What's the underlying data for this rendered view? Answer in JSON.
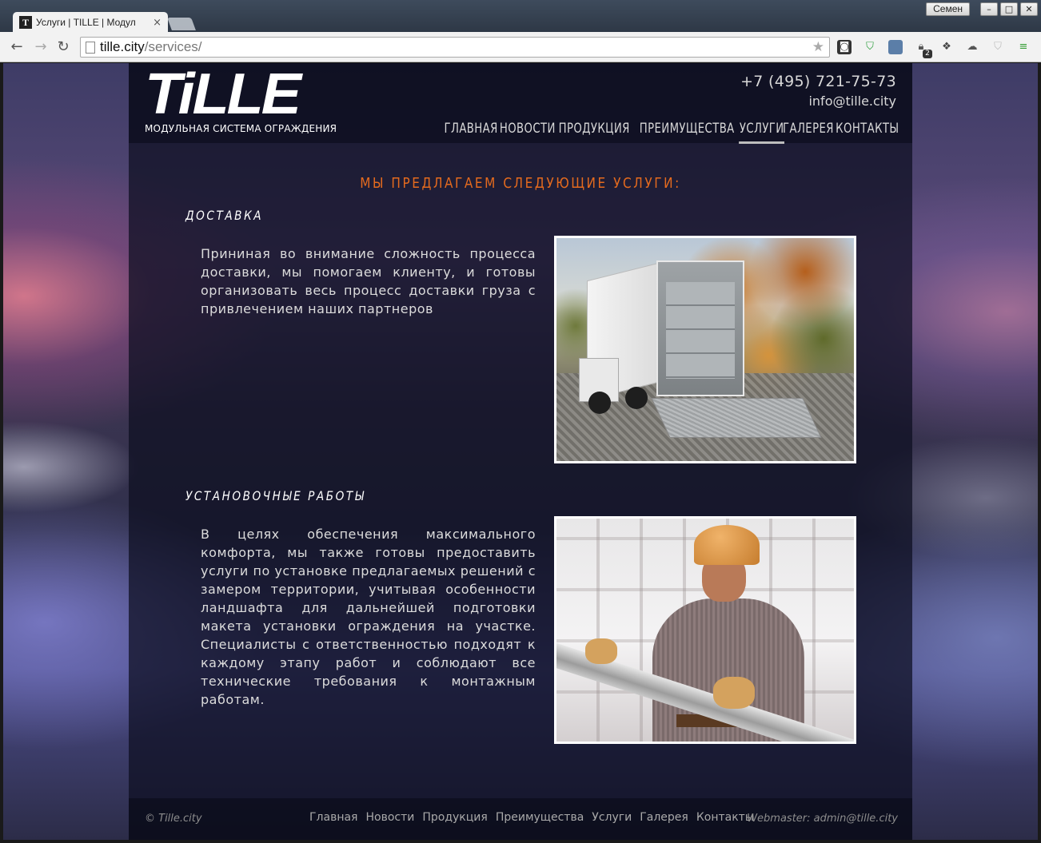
{
  "browser": {
    "tab_title": "Услуги | TILLE | Модул",
    "tab_favicon": "T",
    "close_glyph": "×",
    "user_name": "Семен",
    "url_host": "tille.city",
    "url_path": "/services/",
    "extensions": [
      "readability-icon",
      "shield-icon",
      "book-icon",
      "lock-icon",
      "pocket-icon",
      "cloud-upload-icon",
      "shield-outline-icon",
      "menu-icon"
    ],
    "extension_badge": "2"
  },
  "site": {
    "logo_text": "TiLLE",
    "logo_tagline": "МОДУЛЬНАЯ СИСТЕМА ОГРАЖДЕНИЯ",
    "phone": "+7 (495) 721-75-73",
    "email": "info@tille.city",
    "nav": [
      {
        "label": "ГЛАВНАЯ"
      },
      {
        "label": "НОВОСТИ"
      },
      {
        "label": "ПРОДУКЦИЯ"
      },
      {
        "label": "ПРЕИМУЩЕСТВА"
      },
      {
        "label": "УСЛУГИ"
      },
      {
        "label": "ГАЛЕРЕЯ"
      },
      {
        "label": "КОНТАКТЫ"
      }
    ],
    "active_nav": "УСЛУГИ",
    "accent_color": "#e46a1e"
  },
  "main": {
    "heading": "МЫ ПРЕДЛАГАЕМ СЛЕДУЮЩИЕ УСЛУГИ:",
    "services": [
      {
        "title": "ДОСТАВКА",
        "text": "Прининая во внимание сложность процесса доставки, мы помогаем клиенту, и готовы организовать весь процесс доставки груза с привлечением наших партнеров"
      },
      {
        "title": "УСТАНОВОЧНЫЕ РАБОТЫ",
        "text": "В целях обеспечения максимального комфорта, мы также готовы предоставить услуги по установке предлагаемых решений с замером территории, учитывая особенности ландшафта для дальнейшей подготовки макета установки ограждения на участке. Специалисты с ответственностью подходят к каждому этапу работ и соблюдают все технические требования к монтажным работам."
      }
    ]
  },
  "footer": {
    "copyright": "© Tille.city",
    "links": [
      "Главная",
      "Новости",
      "Продукция",
      "Преимущества",
      "Услуги",
      "Галерея",
      "Контакты"
    ],
    "webmaster": "Webmaster: admin@tille.city"
  }
}
